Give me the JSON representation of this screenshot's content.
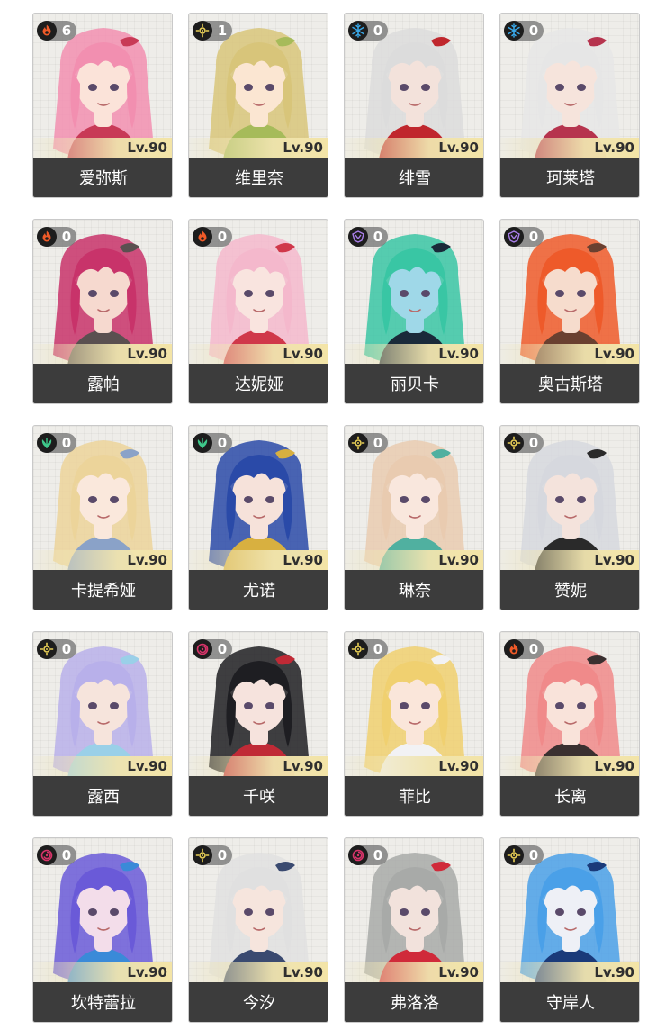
{
  "characters": [
    {
      "name": "爱弥斯",
      "level": "Lv.90",
      "count": "6",
      "element": "fire-icon",
      "hair": "#f28fb0",
      "skin": "#fbe3d9",
      "accent": "#c83a56"
    },
    {
      "name": "维里奈",
      "level": "Lv.90",
      "count": "1",
      "element": "light-icon",
      "hair": "#d8c57a",
      "skin": "#fbe6d2",
      "accent": "#a6bb5a"
    },
    {
      "name": "绯雪",
      "level": "Lv.90",
      "count": "0",
      "element": "ice-icon",
      "hair": "#dcdcdc",
      "skin": "#f3e2db",
      "accent": "#c0272d"
    },
    {
      "name": "珂莱塔",
      "level": "Lv.90",
      "count": "0",
      "element": "ice-icon",
      "hair": "#e6e6e6",
      "skin": "#f6e4dc",
      "accent": "#b6344e"
    },
    {
      "name": "露帕",
      "level": "Lv.90",
      "count": "0",
      "element": "fire-icon",
      "hair": "#c8336a",
      "skin": "#f6d9cf",
      "accent": "#5a5050"
    },
    {
      "name": "达妮娅",
      "level": "Lv.90",
      "count": "0",
      "element": "fire-icon",
      "hair": "#f4b8cc",
      "skin": "#f9e4df",
      "accent": "#d0384a"
    },
    {
      "name": "丽贝卡",
      "level": "Lv.90",
      "count": "0",
      "element": "dark-icon",
      "hair": "#39c6a4",
      "skin": "#9fd8e8",
      "accent": "#1a2a3a"
    },
    {
      "name": "奥古斯塔",
      "level": "Lv.90",
      "count": "0",
      "element": "dark-icon",
      "hair": "#ee5a2a",
      "skin": "#f6dccd",
      "accent": "#6a4030"
    },
    {
      "name": "卡提希娅",
      "level": "Lv.90",
      "count": "0",
      "element": "wind-icon",
      "hair": "#ecd49a",
      "skin": "#fae8dc",
      "accent": "#8aa2c8"
    },
    {
      "name": "尤诺",
      "level": "Lv.90",
      "count": "0",
      "element": "wind-icon",
      "hair": "#2a4aa8",
      "skin": "#f6e2da",
      "accent": "#d8b040"
    },
    {
      "name": "琳奈",
      "level": "Lv.90",
      "count": "0",
      "element": "light-icon",
      "hair": "#e9cbb0",
      "skin": "#f9e7dd",
      "accent": "#50b0a0"
    },
    {
      "name": "赞妮",
      "level": "Lv.90",
      "count": "0",
      "element": "light-icon",
      "hair": "#d6d8de",
      "skin": "#f4e3dc",
      "accent": "#2a2a2a"
    },
    {
      "name": "露西",
      "level": "Lv.90",
      "count": "0",
      "element": "light-icon",
      "hair": "#b8b0ea",
      "skin": "#f6e4dc",
      "accent": "#9ad0e8"
    },
    {
      "name": "千咲",
      "level": "Lv.90",
      "count": "0",
      "element": "havoc-icon",
      "hair": "#1e1e22",
      "skin": "#f6e3dd",
      "accent": "#c02a36"
    },
    {
      "name": "菲比",
      "level": "Lv.90",
      "count": "0",
      "element": "light-icon",
      "hair": "#f0d070",
      "skin": "#fae6da",
      "accent": "#f2f2f4"
    },
    {
      "name": "长离",
      "level": "Lv.90",
      "count": "0",
      "element": "fire-icon",
      "hair": "#f08a8a",
      "skin": "#f9e3da",
      "accent": "#3a3030"
    },
    {
      "name": "坎特蕾拉",
      "level": "Lv.90",
      "count": "0",
      "element": "havoc-icon",
      "hair": "#6a5ad8",
      "skin": "#f3ddea",
      "accent": "#3a8ad8"
    },
    {
      "name": "今汐",
      "level": "Lv.90",
      "count": "0",
      "element": "light-icon",
      "hair": "#e0e0e0",
      "skin": "#f6e5dd",
      "accent": "#3a4a70"
    },
    {
      "name": "弗洛洛",
      "level": "Lv.90",
      "count": "0",
      "element": "havoc-icon",
      "hair": "#a8aaa8",
      "skin": "#f2e2dc",
      "accent": "#d02a3a"
    },
    {
      "name": "守岸人",
      "level": "Lv.90",
      "count": "0",
      "element": "light-icon",
      "hair": "#4aa0e8",
      "skin": "#eef0f6",
      "accent": "#1a3a7a"
    }
  ],
  "colors": {
    "fire": "#f05a28",
    "light": "#e8cf56",
    "ice": "#3aa8e8",
    "dark": "#a87ee8",
    "wind": "#3ec88a",
    "havoc": "#d8346a"
  }
}
